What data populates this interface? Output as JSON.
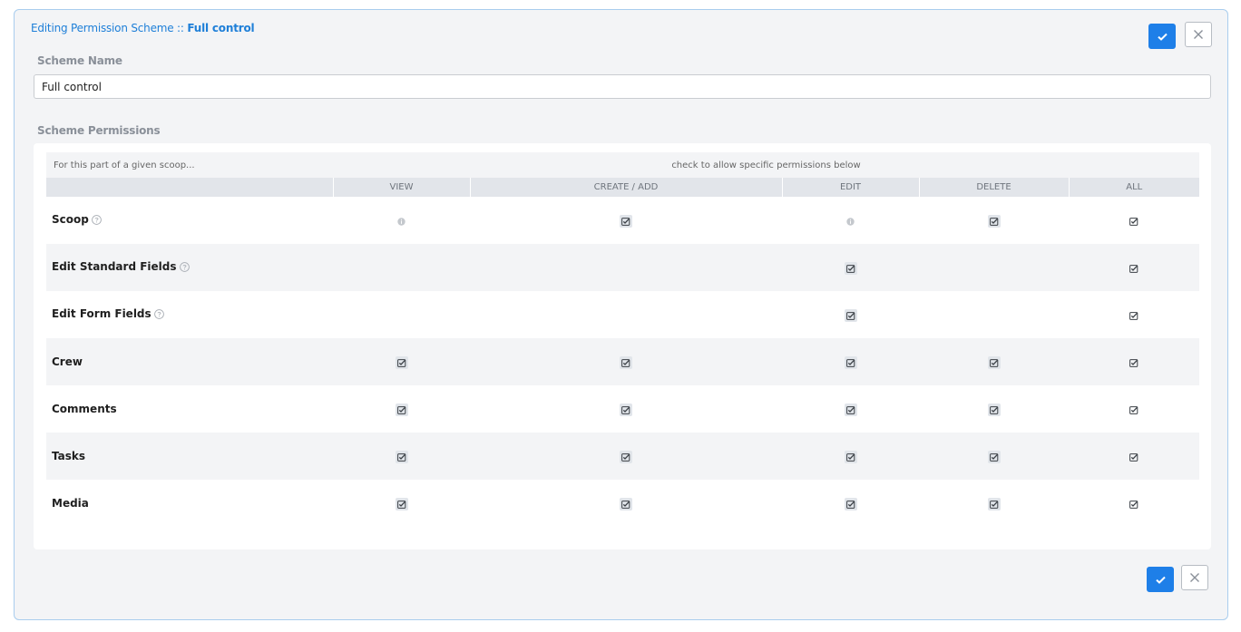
{
  "header": {
    "title_prefix": "Editing Permission Scheme :: ",
    "title_name": "Full control"
  },
  "form": {
    "scheme_name_label": "Scheme Name",
    "scheme_name_value": "Full control",
    "permissions_label": "Scheme Permissions"
  },
  "table": {
    "intro_left": "For this part of a given scoop...",
    "intro_right": "check to allow specific permissions below",
    "columns": [
      "VIEW",
      "CREATE / ADD",
      "EDIT",
      "DELETE",
      "ALL"
    ],
    "rows": [
      {
        "label": "Scoop",
        "help": true,
        "cells": [
          "info",
          "check",
          "info",
          "check",
          "check"
        ]
      },
      {
        "label": "Edit Standard Fields",
        "help": true,
        "cells": [
          "none",
          "none",
          "check",
          "none",
          "check"
        ]
      },
      {
        "label": "Edit Form Fields",
        "help": true,
        "cells": [
          "none",
          "none",
          "check",
          "none",
          "check"
        ]
      },
      {
        "label": "Crew",
        "help": false,
        "cells": [
          "check",
          "check",
          "check",
          "check",
          "check"
        ]
      },
      {
        "label": "Comments",
        "help": false,
        "cells": [
          "check",
          "check",
          "check",
          "check",
          "check"
        ]
      },
      {
        "label": "Tasks",
        "help": false,
        "cells": [
          "check",
          "check",
          "check",
          "check",
          "check"
        ]
      },
      {
        "label": "Media",
        "help": false,
        "cells": [
          "check",
          "check",
          "check",
          "check",
          "check"
        ]
      }
    ]
  },
  "icons": {
    "save": "check-icon",
    "cancel": "close-icon",
    "help": "question-circle-icon",
    "info": "info-circle-icon",
    "checkbox": "checked-box-icon"
  },
  "colors": {
    "accent": "#1e7fe8",
    "panel_border": "#a9cdee",
    "panel_bg": "#f3f4f6"
  }
}
